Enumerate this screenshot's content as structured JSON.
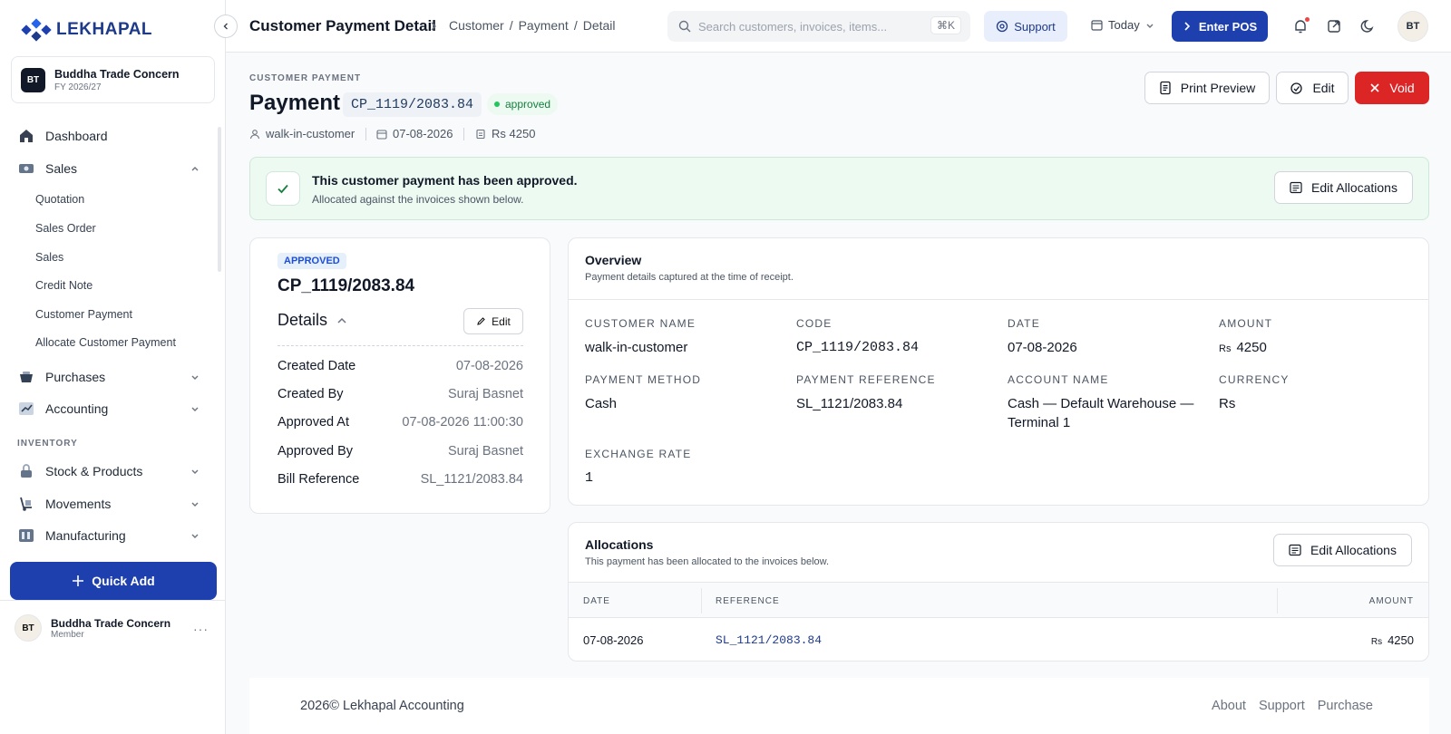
{
  "app": {
    "brand": "LEKHAPAL"
  },
  "org": {
    "initials": "BT",
    "name": "Buddha Trade Concern",
    "fy": "FY 2026/27"
  },
  "nav": {
    "dashboard": "Dashboard",
    "sales": "Sales",
    "sales_sub": [
      "Quotation",
      "Sales Order",
      "Sales",
      "Credit Note",
      "Customer Payment",
      "Allocate Customer Payment"
    ],
    "purchases": "Purchases",
    "accounting": "Accounting",
    "inventory_label": "INVENTORY",
    "stock": "Stock & Products",
    "movements": "Movements",
    "manufacturing": "Manufacturing"
  },
  "quick_add": "Quick Add",
  "user": {
    "initials": "BT",
    "name": "Buddha Trade Concern",
    "role": "Member",
    "more": "···"
  },
  "topbar": {
    "title": "Customer Payment Detail",
    "breadcrumb": [
      "Customer",
      "/",
      "Payment",
      "/",
      "Detail"
    ],
    "search_placeholder": "Search customers, invoices, items...",
    "search_kbd": "⌘K",
    "support": "Support",
    "date_filter": "Today",
    "enter_pos": "Enter POS",
    "avatar": "BT"
  },
  "header": {
    "eyebrow": "CUSTOMER PAYMENT",
    "title": "Payment",
    "code": "CP_1119/2083.84",
    "status": "approved",
    "customer": "walk-in-customer",
    "date": "07-08-2026",
    "amount": "Rs 4250",
    "print_preview": "Print Preview",
    "edit": "Edit",
    "void": "Void"
  },
  "banner": {
    "title": "This customer payment has been approved.",
    "subtitle": "Allocated against the invoices shown below.",
    "button": "Edit Allocations"
  },
  "details_card": {
    "chip": "APPROVED",
    "code": "CP_1119/2083.84",
    "title": "Details",
    "edit": "Edit",
    "rows": [
      {
        "k": "Created Date",
        "v": "07-08-2026"
      },
      {
        "k": "Created By",
        "v": "Suraj Basnet"
      },
      {
        "k": "Approved At",
        "v": "07-08-2026 11:00:30"
      },
      {
        "k": "Approved By",
        "v": "Suraj Basnet"
      },
      {
        "k": "Bill Reference",
        "v": "SL_1121/2083.84"
      }
    ]
  },
  "overview": {
    "title": "Overview",
    "subtitle": "Payment details captured at the time of receipt.",
    "customer_name": {
      "label": "CUSTOMER NAME",
      "value": "walk-in-customer"
    },
    "code": {
      "label": "CODE",
      "value": "CP_1119/2083.84"
    },
    "date": {
      "label": "DATE",
      "value": "07-08-2026"
    },
    "amount": {
      "label": "AMOUNT",
      "currency": "Rs",
      "value": "4250"
    },
    "payment_method": {
      "label": "PAYMENT METHOD",
      "value": "Cash"
    },
    "payment_reference": {
      "label": "PAYMENT REFERENCE",
      "value": "SL_1121/2083.84"
    },
    "account_name": {
      "label": "ACCOUNT NAME",
      "value_line1": "Cash — Default Warehouse —",
      "value_line2": "Terminal 1"
    },
    "currency": {
      "label": "CURRENCY",
      "value": "Rs"
    },
    "exchange_rate": {
      "label": "EXCHANGE RATE",
      "value": "1"
    }
  },
  "allocations": {
    "title": "Allocations",
    "subtitle": "This payment has been allocated to the invoices below.",
    "button": "Edit Allocations",
    "columns": {
      "date": "DATE",
      "reference": "REFERENCE",
      "amount": "AMOUNT"
    },
    "row": {
      "date": "07-08-2026",
      "reference": "SL_1121/2083.84",
      "currency": "Rs",
      "amount": "4250"
    }
  },
  "footer": {
    "copyright": "2026© Lekhapal Accounting",
    "links": [
      "About",
      "Support",
      "Purchase"
    ]
  }
}
